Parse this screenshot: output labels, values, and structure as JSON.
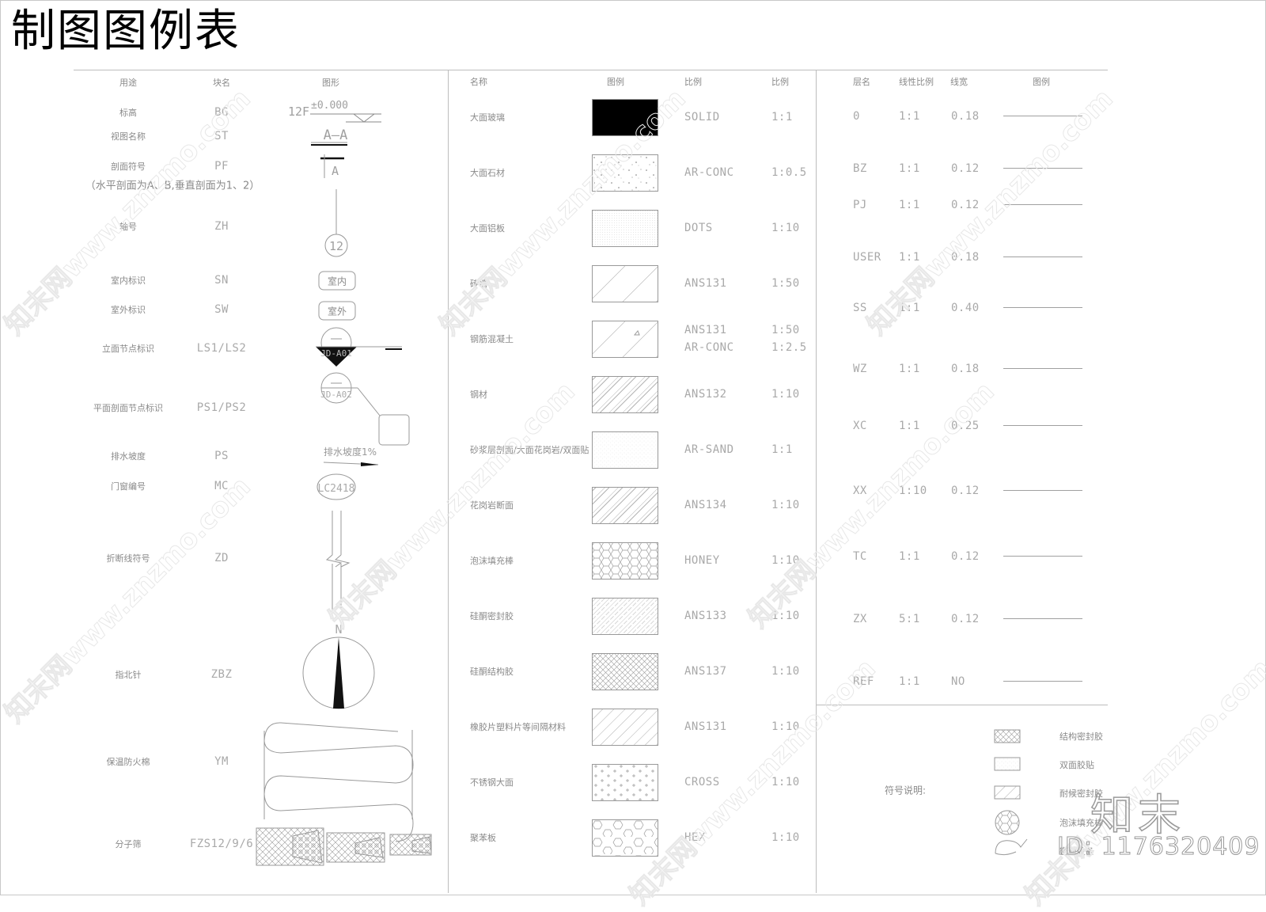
{
  "title": "制图图例表",
  "symbols_table": {
    "headers": {
      "purpose": "用途",
      "block_name": "块名",
      "graphic": "图形"
    },
    "rows": [
      {
        "purpose": "标高",
        "block": "BG"
      },
      {
        "purpose": "视图名称",
        "block": "ST"
      },
      {
        "purpose": "剖面符号",
        "block": "PF",
        "note": "（水平剖面为A、B,垂直剖面为1、2）"
      },
      {
        "purpose": "轴号",
        "block": "ZH"
      },
      {
        "purpose": "室内标识",
        "block": "SN"
      },
      {
        "purpose": "室外标识",
        "block": "SW"
      },
      {
        "purpose": "立面节点标识",
        "block": "LS1/LS2"
      },
      {
        "purpose": "平面剖面节点标识",
        "block": "PS1/PS2"
      },
      {
        "purpose": "排水坡度",
        "block": "PS"
      },
      {
        "purpose": "门窗编号",
        "block": "MC"
      },
      {
        "purpose": "折断线符号",
        "block": "ZD"
      },
      {
        "purpose": "指北针",
        "block": "ZBZ"
      },
      {
        "purpose": "保温防火棉",
        "block": "YM"
      },
      {
        "purpose": "分子筛",
        "block": "FZS12/9/6"
      }
    ],
    "graphic_labels": {
      "elevation_floor": "12F",
      "elevation_value": "±0.000",
      "view_name": "A–A",
      "section_letter": "A",
      "axis_number": "12",
      "indoor": "室内",
      "outdoor": "室外",
      "node_elev": "JD-A01",
      "node_plan": "JD-A02",
      "node_dash": "—",
      "slope": "排水坡度1%",
      "door_window": "LC2418",
      "north": "N"
    }
  },
  "hatch_table": {
    "headers": {
      "name": "名称",
      "legend": "图例",
      "pattern": "比例",
      "scale": "比例"
    },
    "rows": [
      {
        "name": "大面玻璃",
        "pattern": "SOLID",
        "scale": "1:1",
        "swatch": "solid"
      },
      {
        "name": "大面石材",
        "pattern": "AR-CONC",
        "scale": "1:0.5",
        "swatch": "conc"
      },
      {
        "name": "大面铝板",
        "pattern": "DOTS",
        "scale": "1:10",
        "swatch": "dots"
      },
      {
        "name": "砖墙",
        "pattern": "ANS131",
        "scale": "1:50",
        "swatch": "ans131-wide"
      },
      {
        "name": "钢筋混凝土",
        "pattern": "ANS131",
        "pattern2": "AR-CONC",
        "scale": "1:50",
        "scale2": "1:2.5",
        "swatch": "rc"
      },
      {
        "name": "钢材",
        "pattern": "ANS132",
        "scale": "1:10",
        "swatch": "ans132"
      },
      {
        "name": "砂浆层剖面/大面花岗岩/双面贴",
        "pattern": "AR-SAND",
        "scale": "1:1",
        "swatch": "sand"
      },
      {
        "name": "花岗岩断面",
        "pattern": "ANS134",
        "scale": "1:10",
        "swatch": "ans134"
      },
      {
        "name": "泡沫填充棒",
        "pattern": "HONEY",
        "scale": "1:10",
        "swatch": "honey"
      },
      {
        "name": "硅酮密封胶",
        "pattern": "ANS133",
        "scale": "1:10",
        "swatch": "ans133"
      },
      {
        "name": "硅酮结构胶",
        "pattern": "ANS137",
        "scale": "1:10",
        "swatch": "ans137"
      },
      {
        "name": "橡胶片塑料片等间隔材料",
        "pattern": "ANS131",
        "scale": "1:10",
        "swatch": "ans131-fine"
      },
      {
        "name": "不锈钢大面",
        "pattern": "CROSS",
        "scale": "1:10",
        "swatch": "cross"
      },
      {
        "name": "聚苯板",
        "pattern": "HEX",
        "scale": "1:10",
        "swatch": "hex"
      }
    ]
  },
  "layer_table": {
    "headers": {
      "layer": "层名",
      "ltscale": "线性比例",
      "lineweight": "线宽",
      "legend": "图例"
    },
    "rows": [
      {
        "layer": "0",
        "ltscale": "1:1",
        "lineweight": "0.18"
      },
      {
        "layer": "BZ",
        "ltscale": "1:1",
        "lineweight": "0.12"
      },
      {
        "layer": "PJ",
        "ltscale": "1:1",
        "lineweight": "0.12"
      },
      {
        "layer": "USER",
        "ltscale": "1:1",
        "lineweight": "0.18"
      },
      {
        "layer": "SS",
        "ltscale": "1:1",
        "lineweight": "0.40"
      },
      {
        "layer": "WZ",
        "ltscale": "1:1",
        "lineweight": "0.18"
      },
      {
        "layer": "XC",
        "ltscale": "1:1",
        "lineweight": "0.25"
      },
      {
        "layer": "XX",
        "ltscale": "1:10",
        "lineweight": "0.12"
      },
      {
        "layer": "TC",
        "ltscale": "1:1",
        "lineweight": "0.12"
      },
      {
        "layer": "ZX",
        "ltscale": "5:1",
        "lineweight": "0.12"
      },
      {
        "layer": "REF",
        "ltscale": "1:1",
        "lineweight": "NO"
      }
    ]
  },
  "symbol_notes": {
    "label": "符号说明:",
    "items": [
      "结构密封胶",
      "双面胶贴",
      "耐候密封胶",
      "泡沫填充棒",
      "密封胶条"
    ]
  },
  "watermark": {
    "text": "知末网www.znzmo.com",
    "brand": "知末",
    "id": "ID: 1176320409"
  }
}
